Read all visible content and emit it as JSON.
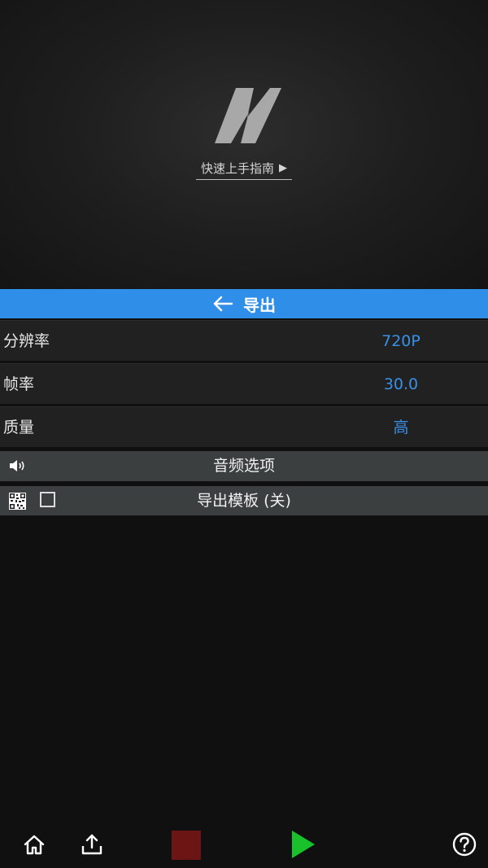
{
  "preview": {
    "logo_icon": "app-logo-n-icon",
    "guide_link_label": "快速上手指南",
    "guide_link_icon": "play-triangle-icon"
  },
  "header": {
    "back_icon": "arrow-left-icon",
    "title": "导出",
    "accent_color": "#2f8ee8"
  },
  "settings": [
    {
      "label": "分辨率",
      "value": "720P"
    },
    {
      "label": "帧率",
      "value": "30.0"
    },
    {
      "label": "质量",
      "value": "高"
    }
  ],
  "audio_options": {
    "icon": "speaker-icon",
    "label": "音频选项"
  },
  "export_template": {
    "icon": "qr-code-icon",
    "checked": false,
    "label": "导出模板 (关)"
  },
  "toolbar": {
    "icons": [
      "home-icon",
      "share-upload-icon",
      "stop-icon",
      "play-icon",
      "help-icon"
    ],
    "stop_color": "#6b1515",
    "play_color": "#19c22a"
  },
  "colors": {
    "value_text": "#3a8fe6",
    "row_background": "#212121",
    "option_background": "#3b3f40"
  }
}
